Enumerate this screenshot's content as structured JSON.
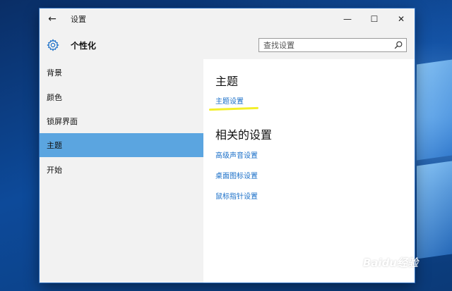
{
  "window": {
    "title": "设置",
    "back_icon": "←",
    "minimize_icon": "—",
    "maximize_icon": "☐",
    "close_icon": "✕"
  },
  "header": {
    "page_title": "个性化",
    "search_placeholder": "查找设置"
  },
  "sidebar": {
    "items": [
      {
        "label": "背景",
        "active": false
      },
      {
        "label": "颜色",
        "active": false
      },
      {
        "label": "锁屏界面",
        "active": false
      },
      {
        "label": "主题",
        "active": true
      },
      {
        "label": "开始",
        "active": false
      }
    ]
  },
  "content": {
    "section1_title": "主题",
    "section1_link": "主题设置",
    "section2_title": "相关的设置",
    "related_links": [
      "高级声音设置",
      "桌面图标设置",
      "鼠标指针设置"
    ]
  },
  "watermark": {
    "brand": "Baidu经验",
    "url": "jingyan.baidu.com"
  },
  "colors": {
    "accent": "#5ba5e0",
    "link": "#1a6fc8",
    "annotation": "#f3ef2a"
  }
}
